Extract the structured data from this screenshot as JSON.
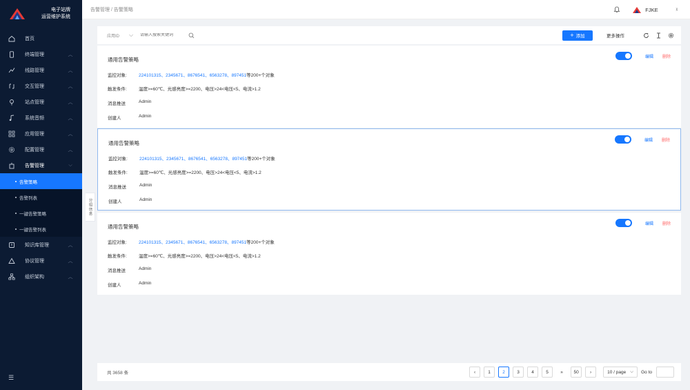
{
  "brand": {
    "line1": "电子站牌",
    "line2": "运营维护系统"
  },
  "sidebar": {
    "items": [
      {
        "name": "home",
        "label": "首页",
        "icon": "home-icon",
        "chevron": false
      },
      {
        "name": "terminal",
        "label": "终端管理",
        "icon": "device-icon",
        "chevron": true
      },
      {
        "name": "line",
        "label": "线路管理",
        "icon": "route-icon",
        "chevron": true
      },
      {
        "name": "interaction",
        "label": "交互管理",
        "icon": "interaction-icon",
        "chevron": true
      },
      {
        "name": "station",
        "label": "站点管理",
        "icon": "location-icon",
        "chevron": true
      },
      {
        "name": "audio",
        "label": "系统音频",
        "icon": "music-icon",
        "chevron": true
      },
      {
        "name": "app",
        "label": "应用管理",
        "icon": "app-grid-icon",
        "chevron": true
      },
      {
        "name": "config",
        "label": "配置管理",
        "icon": "settings-icon",
        "chevron": true
      },
      {
        "name": "alarm",
        "label": "告警管理",
        "icon": "alarm-icon",
        "chevron": true,
        "open": true
      }
    ],
    "alarm_sub": [
      {
        "label": "告警策略",
        "active": true
      },
      {
        "label": "告警列表",
        "active": false
      },
      {
        "label": "一键告警策略",
        "active": false
      },
      {
        "label": "一键告警列表",
        "active": false
      }
    ],
    "items_after": [
      {
        "name": "knowledge",
        "label": "知识库管理",
        "icon": "book-icon",
        "chevron": true
      },
      {
        "name": "protocol",
        "label": "协议管理",
        "icon": "protocol-icon",
        "chevron": true
      },
      {
        "name": "org",
        "label": "组织架构",
        "icon": "org-icon",
        "chevron": true
      }
    ]
  },
  "drawer_tab": "分组信息",
  "header": {
    "breadcrumb": "告警管理 / 告警策略",
    "user": "FJKE",
    "lang_icon": "translate-icon"
  },
  "toolbar": {
    "select_value": "应用ID",
    "search_placeholder": "请输入搜索关键词",
    "add_label": "添加",
    "more_label": "更多操作"
  },
  "cards": [
    {
      "title": "通用告警策略",
      "monitor_label": "监控对象:",
      "monitor_ids": "224101315、2345671、8676541、6563278、897451",
      "monitor_suffix": "等200+个对象",
      "trigger_label": "触发条件:",
      "trigger": "温度>=60℃、光感亮度>=2200、电压>24<电压<5、电流>1.2",
      "push_label": "消息推送",
      "push": "Admin",
      "creator_label": "创建人",
      "creator": "Admin",
      "edit": "编辑",
      "delete": "删除",
      "enabled": true,
      "selected": false
    },
    {
      "title": "通用告警策略",
      "monitor_label": "监控对象:",
      "monitor_ids": "224101315、2345671、8676541、6563278、897451",
      "monitor_suffix": "等200+个对象",
      "trigger_label": "触发条件:",
      "trigger": "温度>=60℃、光感亮度>=2200、电压>24<电压<5、电流>1.2",
      "push_label": "消息推送",
      "push": "Admin",
      "creator_label": "创建人",
      "creator": "Admin",
      "edit": "编辑",
      "delete": "删除",
      "enabled": true,
      "selected": true
    },
    {
      "title": "通用告警策略",
      "monitor_label": "监控对象:",
      "monitor_ids": "224101315、2345671、8676541、6563278、897451",
      "monitor_suffix": "等200+个对象",
      "trigger_label": "触发条件:",
      "trigger": "温度>=60℃、光感亮度>=2200、电压>24<电压<5、电流>1.2",
      "push_label": "消息推送",
      "push": "Admin",
      "creator_label": "创建人",
      "creator": "Admin",
      "edit": "编辑",
      "delete": "删除",
      "enabled": true,
      "selected": false
    }
  ],
  "pagination": {
    "total": "共 3658 条",
    "pages": [
      "1",
      "2",
      "3",
      "4",
      "5"
    ],
    "current": "2",
    "ellipsis": "»",
    "last": "50",
    "page_size": "10 / page",
    "goto": "Go to"
  },
  "colors": {
    "primary": "#1677ff",
    "sidebar_bg": "#0c1b33",
    "danger": "#ff6b6b"
  }
}
